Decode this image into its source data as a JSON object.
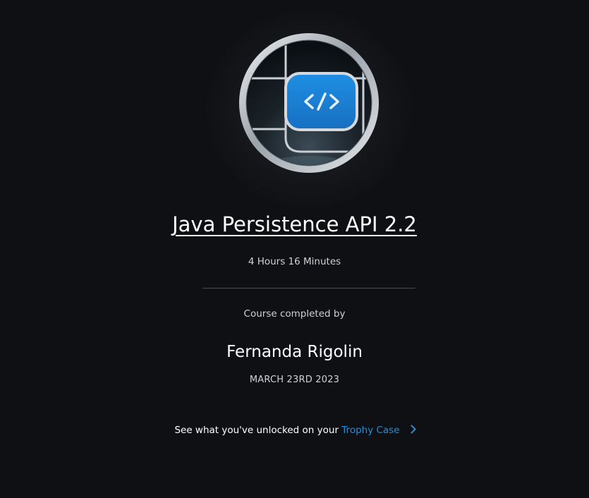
{
  "course": {
    "title": "Java Persistence API 2.2",
    "duration": "4 Hours 16 Minutes",
    "badge_icon": "code-brackets-icon"
  },
  "completion": {
    "label": "Course completed by",
    "learner_name": "Fernanda Rigolin",
    "date": "MARCH 23RD 2023"
  },
  "unlock": {
    "prefix": "See what you've unlocked on your ",
    "link_label": "Trophy Case"
  },
  "colors": {
    "background": "#0f1014",
    "accent": "#1f8fde",
    "badge_blue": "#1b84d8"
  }
}
